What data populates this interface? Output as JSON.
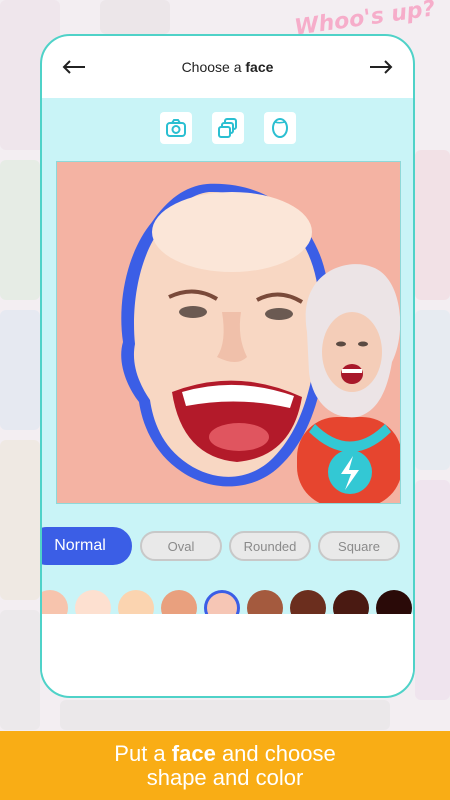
{
  "background": {
    "sticker_text": "Whoo's up?"
  },
  "header": {
    "title_prefix": "Choose a ",
    "title_bold": "face",
    "back_icon": "arrow-left-icon",
    "forward_icon": "arrow-right-icon"
  },
  "toolbar": {
    "items": [
      {
        "icon": "camera-icon"
      },
      {
        "icon": "gallery-icon"
      },
      {
        "icon": "face-outline-icon"
      }
    ]
  },
  "shapes": {
    "options": [
      "Normal",
      "Oval",
      "Rounded",
      "Square"
    ],
    "selected": "Normal"
  },
  "colors": {
    "swatches": [
      "#f7c4ad",
      "#fde0d0",
      "#fbd4b0",
      "#e9a07e",
      "#f6c6b5",
      "#a45a3e",
      "#6b2e1e",
      "#4a1a12",
      "#2a0a08"
    ],
    "selected_index": 4,
    "accent": "#3b5ee6",
    "frame": "#4fd2c8",
    "screen": "#c9f4f7",
    "banner": "#f9ad15"
  },
  "banner": {
    "line1_prefix": "Put a ",
    "line1_bold": "face",
    "line1_suffix": " and choose",
    "line2": "shape and color"
  }
}
